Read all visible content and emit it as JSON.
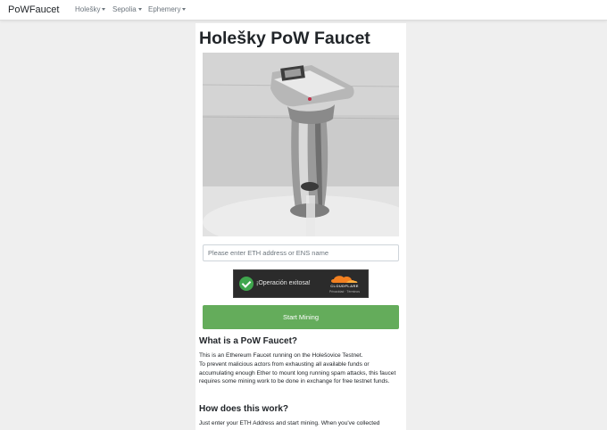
{
  "navbar": {
    "brand": "PoWFaucet",
    "items": [
      {
        "label": "Holešky"
      },
      {
        "label": "Sepolia"
      },
      {
        "label": "Ephemery"
      }
    ]
  },
  "main": {
    "title": "Holešky PoW Faucet",
    "image_alt": "faucet tap image",
    "address_placeholder": "Please enter ETH address or ENS name",
    "captcha": {
      "status": "¡Operación exitosa!",
      "brand": "CLOUDFLARE",
      "links": "Privacidad · Términos"
    },
    "start_button": "Start Mining",
    "sections": [
      {
        "heading": "What is a PoW Faucet?",
        "paragraphs": [
          "This is an Ethereum Faucet running on the Holešovice Testnet.",
          "To prevent malicious actors from exhausting all available funds or accumulating enough Ether to mount long running spam attacks, this faucet requires some mining work to be done in exchange for free testnet funds."
        ]
      },
      {
        "heading": "How does this work?",
        "paragraphs": [
          "Just enter your ETH Address and start mining. When you've collected"
        ]
      }
    ]
  },
  "colors": {
    "accent_green": "#64ac5b",
    "page_bg": "#efefef",
    "captcha_bg": "#2b2b2b",
    "cloudflare_orange": "#f38020"
  }
}
